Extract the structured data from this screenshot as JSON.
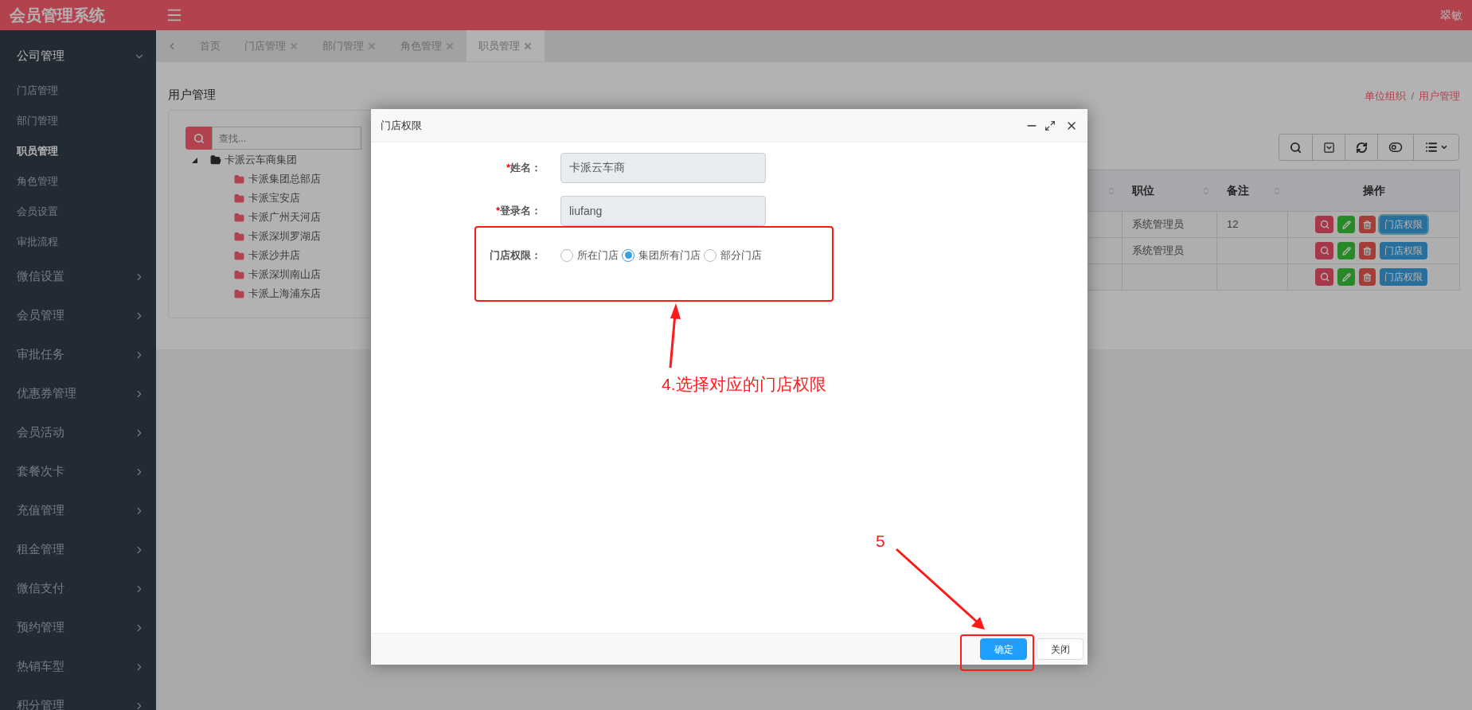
{
  "header": {
    "logo": "会员管理系统",
    "user": "翠敏"
  },
  "sidebar": {
    "items": [
      {
        "label": "公司管理",
        "expanded": true,
        "children": [
          {
            "label": "门店管理",
            "selected": false
          },
          {
            "label": "部门管理",
            "selected": false
          },
          {
            "label": "职员管理",
            "selected": true
          },
          {
            "label": "角色管理",
            "selected": false
          },
          {
            "label": "会员设置",
            "selected": false
          },
          {
            "label": "审批流程",
            "selected": false
          }
        ]
      },
      {
        "label": "微信设置",
        "expanded": false
      },
      {
        "label": "会员管理",
        "expanded": false
      },
      {
        "label": "审批任务",
        "expanded": false
      },
      {
        "label": "优惠券管理",
        "expanded": false
      },
      {
        "label": "会员活动",
        "expanded": false
      },
      {
        "label": "套餐次卡",
        "expanded": false
      },
      {
        "label": "充值管理",
        "expanded": false
      },
      {
        "label": "租金管理",
        "expanded": false
      },
      {
        "label": "微信支付",
        "expanded": false
      },
      {
        "label": "预约管理",
        "expanded": false
      },
      {
        "label": "热销车型",
        "expanded": false
      },
      {
        "label": "积分管理",
        "expanded": false
      }
    ]
  },
  "tabs": [
    {
      "label": "首页",
      "closable": false,
      "selected": false
    },
    {
      "label": "门店管理",
      "closable": true,
      "selected": false
    },
    {
      "label": "部门管理",
      "closable": true,
      "selected": false
    },
    {
      "label": "角色管理",
      "closable": true,
      "selected": false
    },
    {
      "label": "职员管理",
      "closable": true,
      "selected": true
    }
  ],
  "page": {
    "title": "用户管理",
    "breadcrumb": [
      "单位组织",
      "用户管理"
    ],
    "separator": "/"
  },
  "tree": {
    "search_placeholder": "查找...",
    "root": {
      "label": "卡派云车商集团",
      "expanded": true,
      "children": [
        {
          "label": "卡派集团总部店"
        },
        {
          "label": "卡派宝安店"
        },
        {
          "label": "卡派广州天河店"
        },
        {
          "label": "卡派深圳罗湖店"
        },
        {
          "label": "卡派沙井店"
        },
        {
          "label": "卡派深圳南山店"
        },
        {
          "label": "卡派上海浦东店"
        }
      ]
    }
  },
  "table": {
    "columns": [
      "职位",
      "备注",
      "操作"
    ],
    "rows": [
      {
        "position": "系统管理员",
        "note": "12",
        "action": "门店权限",
        "focused": true
      },
      {
        "position": "系统管理员",
        "action": "门店权限",
        "focused": false
      },
      {
        "action": "门店权限",
        "focused": false
      }
    ]
  },
  "modal": {
    "title": "门店权限",
    "fields": [
      {
        "mark": "*",
        "label": "姓名：",
        "value": "卡派云车商"
      },
      {
        "mark": "*",
        "label": "登录名：",
        "value": "liufang"
      }
    ],
    "permission": {
      "label": "门店权限：",
      "options": [
        {
          "label": "所在门店",
          "selected": false
        },
        {
          "label": "集团所有门店",
          "selected": true
        },
        {
          "label": "部分门店",
          "selected": false
        }
      ]
    },
    "buttons": [
      {
        "label": "确定",
        "kind": "primary"
      },
      {
        "label": "关闭",
        "kind": "default"
      }
    ]
  },
  "annotations": [
    {
      "text": "4.选择对应的门店权限"
    },
    {
      "text": "5"
    }
  ]
}
